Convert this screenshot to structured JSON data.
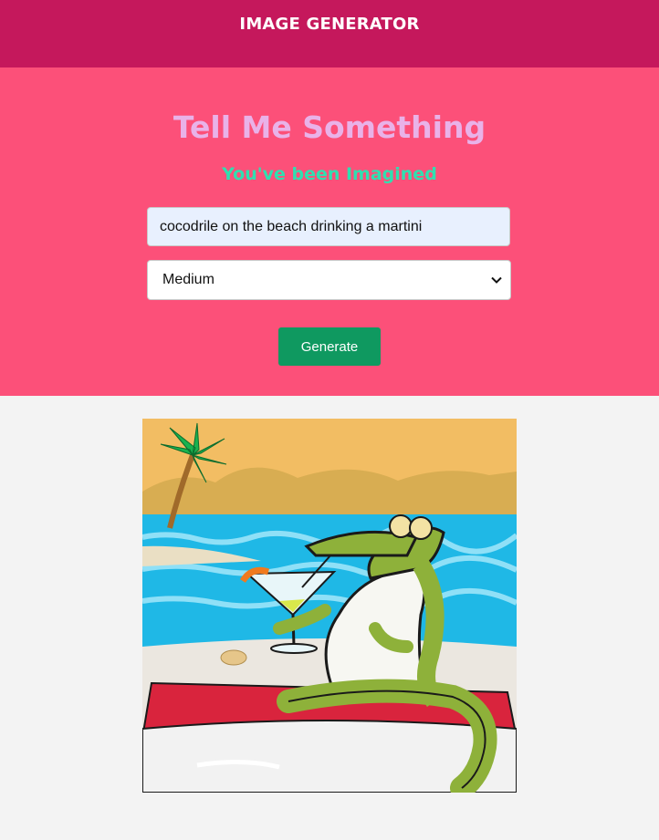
{
  "header": {
    "title": "IMAGE GENERATOR"
  },
  "hero": {
    "heading": "Tell Me Something",
    "subtitle": "You've been Imagined"
  },
  "form": {
    "prompt_value": "cocodrile on the beach drinking a martini",
    "size_selected": "Medium",
    "generate_label": "Generate"
  },
  "colors": {
    "header_bg": "#c5185c",
    "hero_bg": "#fc5079",
    "heading": "#e9b2e8",
    "subtitle": "#2fe0b0",
    "button": "#0f9960"
  },
  "result": {
    "image": "generated-image"
  }
}
